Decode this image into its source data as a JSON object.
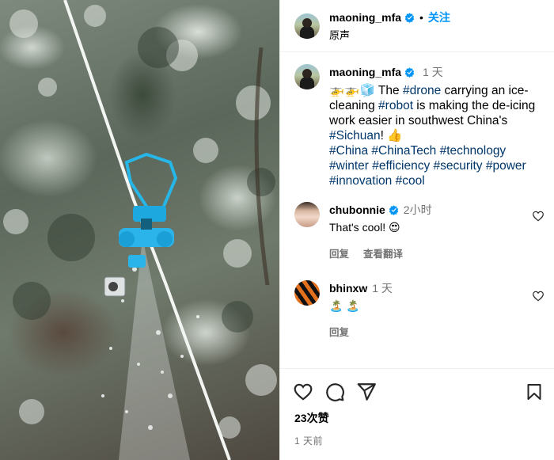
{
  "header": {
    "username": "maoning_mfa",
    "separator": "•",
    "follow_label": "关注",
    "audio_label": "原声"
  },
  "caption": {
    "username": "maoning_mfa",
    "time": "1 天",
    "emoji_prefix": "🚁🚁🧊",
    "t1": " The ",
    "tag_drone": "#drone",
    "t2": " carrying an ice-cleaning ",
    "tag_robot": "#robot",
    "t3": " is making the de-icing work easier in southwest China's ",
    "tag_sichuan": "#Sichuan",
    "t4": "! 👍",
    "tags_line1": "#China #ChinaTech #technology",
    "tags_line2": "#winter #efficiency #security #power",
    "tags_line3": "#innovation #cool"
  },
  "comments": [
    {
      "username": "chubonnie",
      "time": "2小时",
      "text": "That's cool! 😍",
      "reply_label": "回复",
      "translate_label": "查看翻译"
    },
    {
      "username": "bhinxw",
      "time": "1 天",
      "text": "🏝️ 🏝️",
      "reply_label": "回复"
    }
  ],
  "footer": {
    "likes": "23次赞",
    "posted": "1 天前"
  },
  "colors": {
    "link": "#00376b",
    "follow": "#0095f6",
    "muted": "#737373",
    "verified": "#0095f6",
    "robot": "#1ea8e0"
  },
  "icons": [
    "verified-badge-icon",
    "heart-icon",
    "comment-icon",
    "share-icon",
    "save-icon"
  ]
}
